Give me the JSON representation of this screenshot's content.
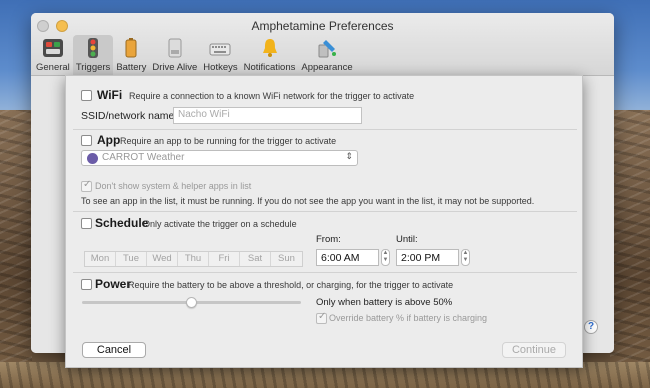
{
  "window": {
    "title": "Amphetamine Preferences"
  },
  "toolbar": {
    "items": [
      {
        "label": "General",
        "icon": "general-switches-icon",
        "active": false
      },
      {
        "label": "Triggers",
        "icon": "traffic-light-icon",
        "active": true
      },
      {
        "label": "Battery",
        "icon": "battery-icon",
        "active": false
      },
      {
        "label": "Drive Alive",
        "icon": "drive-icon",
        "active": false
      },
      {
        "label": "Hotkeys",
        "icon": "keyboard-icon",
        "active": false
      },
      {
        "label": "Notifications",
        "icon": "bell-icon",
        "active": false
      },
      {
        "label": "Appearance",
        "icon": "paint-icon",
        "active": false
      }
    ]
  },
  "help": {
    "label": "?"
  },
  "sheet": {
    "wifi": {
      "checked": false,
      "name": "WiFi",
      "desc": "Require a connection to a known WiFi network for the trigger to activate",
      "ssid_label": "SSID/network name:",
      "ssid_placeholder": "Nacho WiFi"
    },
    "app": {
      "checked": false,
      "name": "App",
      "desc": "Require an app to be running for the trigger to activate",
      "selected_app": "CARROT Weather",
      "hide_helpers_label": "Don't show system & helper apps in list",
      "hide_helpers_checked": true,
      "info": "To see an app in the list, it must be running. If you do not see the app you want in the list, it may not be supported."
    },
    "schedule": {
      "checked": false,
      "name": "Schedule",
      "desc": "Only activate the trigger on a schedule",
      "days": [
        "Mon",
        "Tue",
        "Wed",
        "Thu",
        "Fri",
        "Sat",
        "Sun"
      ],
      "from_label": "From:",
      "from_value": "6:00 AM",
      "until_label": "Until:",
      "until_value": "2:00 PM"
    },
    "power": {
      "checked": false,
      "name": "Power",
      "desc": "Require the battery to be above a threshold, or charging, for the trigger to activate",
      "threshold_percent": 50,
      "threshold_label": "Only when battery is above 50%",
      "override_label": "Override battery % if battery is charging",
      "override_checked": true
    },
    "buttons": {
      "cancel": "Cancel",
      "continue": "Continue"
    }
  }
}
